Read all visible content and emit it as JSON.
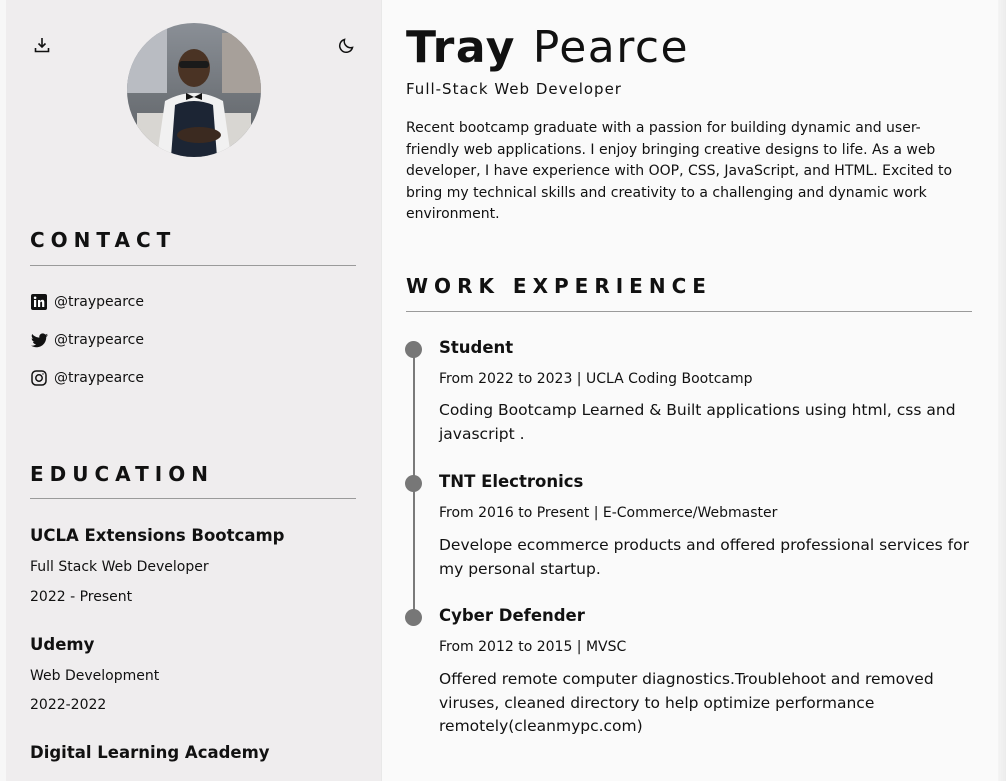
{
  "sidebar": {
    "download_icon": "download-icon",
    "theme_icon": "moon-icon",
    "avatar_alt": "Tray Pearce profile photo",
    "contact": {
      "title": "CONTACT",
      "items": [
        {
          "icon": "linkedin-icon",
          "label": "@traypearce"
        },
        {
          "icon": "twitter-icon",
          "label": "@traypearce"
        },
        {
          "icon": "instagram-icon",
          "label": "@traypearce"
        }
      ]
    },
    "education": {
      "title": "EDUCATION",
      "items": [
        {
          "school": "UCLA Extensions Bootcamp",
          "program": "Full Stack Web Developer",
          "dates": "2022 - Present"
        },
        {
          "school": "Udemy",
          "program": "Web Development",
          "dates": "2022-2022"
        },
        {
          "school": "Digital Learning Academy"
        }
      ]
    }
  },
  "main": {
    "first_name": "Tray",
    "last_name": "Pearce",
    "role": "Full-Stack Web Developer",
    "summary": "Recent bootcamp graduate with a passion for building dynamic and user-friendly web applications. I enjoy bringing creative designs to life. As a web developer, I have experience with OOP, CSS, JavaScript, and HTML. Excited to bring my technical skills and creativity to a challenging and dynamic work environment.",
    "work": {
      "title": "WORK EXPERIENCE",
      "jobs": [
        {
          "title": "Student",
          "meta": "From 2022 to 2023 | UCLA Coding Bootcamp",
          "desc": "Coding Bootcamp Learned & Built applications using html, css and javascript ."
        },
        {
          "title": "TNT Electronics",
          "meta": "From 2016 to Present | E-Commerce/Webmaster",
          "desc": "Develope ecommerce products and offered professional services for my personal startup."
        },
        {
          "title": "Cyber Defender",
          "meta": "From 2012 to 2015 | MVSC",
          "desc": "Offered remote computer diagnostics.Troublehoot and removed viruses, cleaned directory to help optimize performance remotely(cleanmypc.com)"
        }
      ]
    }
  },
  "colors": {
    "sidebar_bg": "#efedee",
    "main_bg": "#fafafa",
    "timeline": "#777777"
  }
}
